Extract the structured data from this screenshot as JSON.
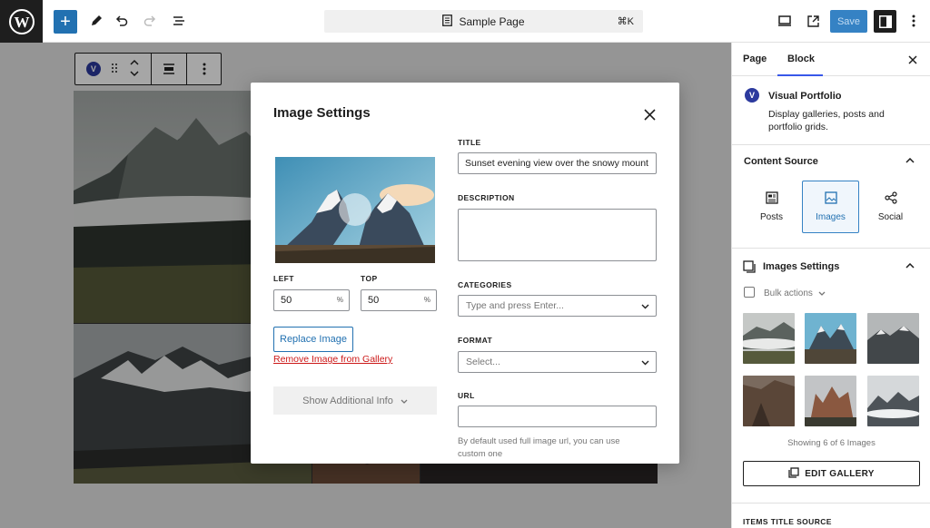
{
  "topbar": {
    "document_title": "Sample Page",
    "shortcut": "⌘K",
    "save_label": "Save"
  },
  "modal": {
    "title": "Image Settings",
    "left_label": "LEFT",
    "left_value": "50",
    "top_label": "TOP",
    "top_value": "50",
    "unit": "%",
    "replace_label": "Replace Image",
    "remove_label": "Remove Image from Gallery",
    "show_info_label": "Show Additional Info",
    "title_label": "TITLE",
    "title_value": "Sunset evening view over the snowy mount",
    "description_label": "DESCRIPTION",
    "categories_label": "CATEGORIES",
    "categories_placeholder": "Type and press Enter...",
    "format_label": "FORMAT",
    "format_placeholder": "Select...",
    "url_label": "URL",
    "url_help": "By default used full image url, you can use custom one"
  },
  "sidebar": {
    "tab_page": "Page",
    "tab_block": "Block",
    "block_name": "Visual Portfolio",
    "block_description": "Display galleries, posts and portfolio grids.",
    "content_source_title": "Content Source",
    "sources": [
      "Posts",
      "Images",
      "Social"
    ],
    "active_source": "Images",
    "images_settings_title": "Images Settings",
    "bulk_actions": "Bulk actions",
    "showing_text": "Showing 6 of 6 Images",
    "edit_gallery_label": "EDIT GALLERY",
    "items_title_source": "ITEMS TITLE SOURCE"
  },
  "colors": {
    "accent": "#2271b1",
    "danger": "#cc1818",
    "dark": "#1e1e1e"
  }
}
